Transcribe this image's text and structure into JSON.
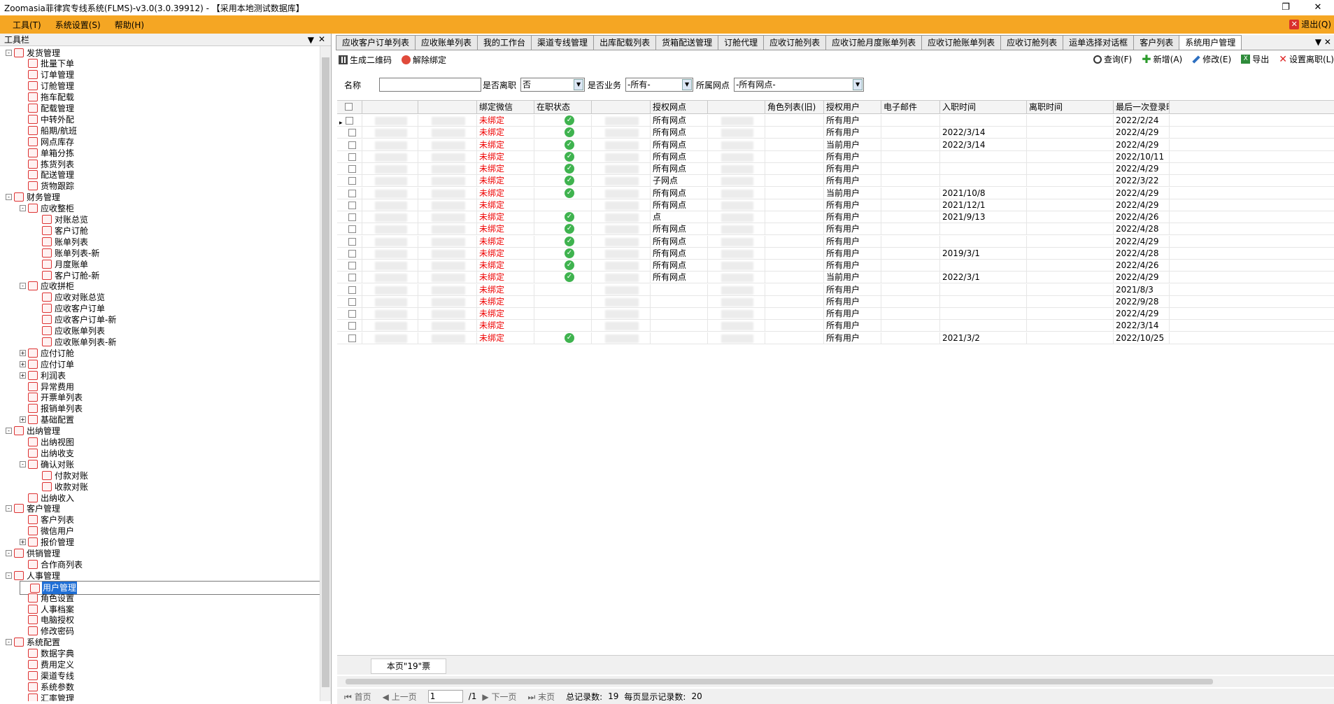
{
  "window": {
    "title": "Zoomasia菲律宾专线系统(FLMS)-v3.0(3.0.39912) - 【采用本地测试数据库】",
    "restore": "❐",
    "close": "✕"
  },
  "menu": {
    "items": [
      "工具(T)",
      "系统设置(S)",
      "帮助(H)"
    ],
    "exit": "退出(Q)"
  },
  "panel": {
    "title": "工具栏",
    "pin": "▼",
    "close": "✕"
  },
  "tree": [
    {
      "label": "发货管理",
      "level": 0,
      "exp": "-"
    },
    {
      "label": "批量下单",
      "level": 1
    },
    {
      "label": "订单管理",
      "level": 1
    },
    {
      "label": "订舱管理",
      "level": 1
    },
    {
      "label": "拖车配载",
      "level": 1
    },
    {
      "label": "配载管理",
      "level": 1
    },
    {
      "label": "中转外配",
      "level": 1
    },
    {
      "label": "船期/航班",
      "level": 1
    },
    {
      "label": "网点库存",
      "level": 1
    },
    {
      "label": "单箱分拣",
      "level": 1
    },
    {
      "label": "拣货列表",
      "level": 1
    },
    {
      "label": "配送管理",
      "level": 1
    },
    {
      "label": "货物跟踪",
      "level": 1
    },
    {
      "label": "财务管理",
      "level": 0,
      "exp": "-"
    },
    {
      "label": "应收整柜",
      "level": 1,
      "exp": "-"
    },
    {
      "label": "对账总览",
      "level": 2
    },
    {
      "label": "客户订舱",
      "level": 2
    },
    {
      "label": "账单列表",
      "level": 2
    },
    {
      "label": "账单列表-新",
      "level": 2
    },
    {
      "label": "月度账单",
      "level": 2
    },
    {
      "label": "客户订舱-新",
      "level": 2
    },
    {
      "label": "应收拼柜",
      "level": 1,
      "exp": "-"
    },
    {
      "label": "应收对账总览",
      "level": 2
    },
    {
      "label": "应收客户订单",
      "level": 2
    },
    {
      "label": "应收客户订单-新",
      "level": 2
    },
    {
      "label": "应收账单列表",
      "level": 2
    },
    {
      "label": "应收账单列表-新",
      "level": 2
    },
    {
      "label": "应付订舱",
      "level": 1,
      "exp": "+"
    },
    {
      "label": "应付订单",
      "level": 1,
      "exp": "+"
    },
    {
      "label": "利润表",
      "level": 1,
      "exp": "+"
    },
    {
      "label": "异常费用",
      "level": 1
    },
    {
      "label": "开票单列表",
      "level": 1
    },
    {
      "label": "报销单列表",
      "level": 1
    },
    {
      "label": "基础配置",
      "level": 1,
      "exp": "+"
    },
    {
      "label": "出纳管理",
      "level": 0,
      "exp": "-"
    },
    {
      "label": "出纳视图",
      "level": 1
    },
    {
      "label": "出纳收支",
      "level": 1
    },
    {
      "label": "确认对账",
      "level": 1,
      "exp": "-"
    },
    {
      "label": "付款对账",
      "level": 2
    },
    {
      "label": "收款对账",
      "level": 2
    },
    {
      "label": "出纳收入",
      "level": 1
    },
    {
      "label": "客户管理",
      "level": 0,
      "exp": "-"
    },
    {
      "label": "客户列表",
      "level": 1
    },
    {
      "label": "微信用户",
      "level": 1
    },
    {
      "label": "报价管理",
      "level": 1,
      "exp": "+"
    },
    {
      "label": "供销管理",
      "level": 0,
      "exp": "-"
    },
    {
      "label": "合作商列表",
      "level": 1
    },
    {
      "label": "人事管理",
      "level": 0,
      "exp": "-"
    },
    {
      "label": "用户管理",
      "level": 1,
      "selected": true
    },
    {
      "label": "角色设置",
      "level": 1
    },
    {
      "label": "人事档案",
      "level": 1
    },
    {
      "label": "电脑授权",
      "level": 1
    },
    {
      "label": "修改密码",
      "level": 1
    },
    {
      "label": "系统配置",
      "level": 0,
      "exp": "-"
    },
    {
      "label": "数据字典",
      "level": 1
    },
    {
      "label": "费用定义",
      "level": 1
    },
    {
      "label": "渠道专线",
      "level": 1
    },
    {
      "label": "系统参数",
      "level": 1
    },
    {
      "label": "汇率管理",
      "level": 1
    }
  ],
  "tabs": [
    "应收客户订单列表",
    "应收账单列表",
    "我的工作台",
    "渠道专线管理",
    "出库配载列表",
    "货箱配送管理",
    "订舱代理",
    "应收订舱列表",
    "应收订舱月度账单列表",
    "应收订舱账单列表",
    "应收订舱列表",
    "运单选择对话框",
    "客户列表",
    "系统用户管理"
  ],
  "tabs_more": "▼ ✕",
  "toolbar": {
    "qrcode": "生成二维码",
    "unbind": "解除绑定",
    "query": "查询(F)",
    "add": "新增(A)",
    "edit": "修改(E)",
    "export": "导出",
    "permissions": "设置离职(L)"
  },
  "filter": {
    "name_label": "名称",
    "name_value": "",
    "resigned_label": "是否离职",
    "resigned_value": "否",
    "business_label": "是否业务",
    "business_value": "-所有-",
    "site_label": "所属网点",
    "site_value": "-所有网点-"
  },
  "columns": [
    "",
    "",
    "",
    "绑定微信",
    "在职状态",
    "",
    "授权网点",
    "",
    "角色列表(旧)",
    "授权用户",
    "电子邮件",
    "入职时间",
    "离职时间",
    "最后一次登录时"
  ],
  "rows": [
    {
      "wx": "未绑定",
      "ok": true,
      "site": "所有网点",
      "user": "所有用户",
      "join": "",
      "last": "2022/2/24",
      "cur": true
    },
    {
      "wx": "未绑定",
      "ok": true,
      "site": "所有网点",
      "user": "所有用户",
      "join": "2022/3/14",
      "last": "2022/4/29"
    },
    {
      "wx": "未绑定",
      "ok": true,
      "site": "所有网点",
      "user": "当前用户",
      "join": "2022/3/14",
      "last": "2022/4/29"
    },
    {
      "wx": "未绑定",
      "ok": true,
      "site": "所有网点",
      "user": "所有用户",
      "join": "",
      "last": "2022/10/11"
    },
    {
      "wx": "未绑定",
      "ok": true,
      "site": "所有网点",
      "user": "所有用户",
      "join": "",
      "last": "2022/4/29"
    },
    {
      "wx": "未绑定",
      "ok": true,
      "site": "子网点",
      "user": "所有用户",
      "join": "",
      "last": "2022/3/22"
    },
    {
      "wx": "未绑定",
      "ok": true,
      "site": "所有网点",
      "user": "当前用户",
      "join": "2021/10/8",
      "last": "2022/4/29"
    },
    {
      "wx": "未绑定",
      "ok": false,
      "site": "所有网点",
      "user": "所有用户",
      "join": "2021/12/1",
      "last": "2022/4/29"
    },
    {
      "wx": "未绑定",
      "ok": true,
      "site": "点",
      "user": "所有用户",
      "join": "2021/9/13",
      "last": "2022/4/26"
    },
    {
      "wx": "未绑定",
      "ok": true,
      "site": "所有网点",
      "user": "所有用户",
      "join": "",
      "last": "2022/4/28"
    },
    {
      "wx": "未绑定",
      "ok": true,
      "site": "所有网点",
      "user": "所有用户",
      "join": "",
      "last": "2022/4/29"
    },
    {
      "wx": "未绑定",
      "ok": true,
      "site": "所有网点",
      "user": "所有用户",
      "join": "2019/3/1",
      "last": "2022/4/28"
    },
    {
      "wx": "未绑定",
      "ok": true,
      "site": "所有网点",
      "user": "所有用户",
      "join": "",
      "last": "2022/4/26"
    },
    {
      "wx": "未绑定",
      "ok": true,
      "site": "所有网点",
      "user": "当前用户",
      "join": "2022/3/1",
      "last": "2022/4/29"
    },
    {
      "wx": "未绑定",
      "ok": false,
      "site": "",
      "user": "所有用户",
      "join": "",
      "last": "2021/8/3"
    },
    {
      "wx": "未绑定",
      "ok": false,
      "site": "",
      "user": "所有用户",
      "join": "",
      "last": "2022/9/28"
    },
    {
      "wx": "未绑定",
      "ok": false,
      "site": "",
      "user": "所有用户",
      "join": "",
      "last": "2022/4/29"
    },
    {
      "wx": "未绑定",
      "ok": false,
      "site": "",
      "user": "所有用户",
      "join": "",
      "last": "2022/3/14"
    },
    {
      "wx": "未绑定",
      "ok": true,
      "site": "",
      "user": "所有用户",
      "join": "2021/3/2",
      "last": "2022/10/25"
    }
  ],
  "footer": {
    "page_summary": "本页\"19\"票"
  },
  "pager": {
    "first": "首页",
    "prev": "上一页",
    "page": "1",
    "total_pages": "/1",
    "next": "下一页",
    "last": "末页",
    "total_label": "总记录数:",
    "total": "19",
    "per_label": "每页显示记录数:",
    "per": "20"
  }
}
